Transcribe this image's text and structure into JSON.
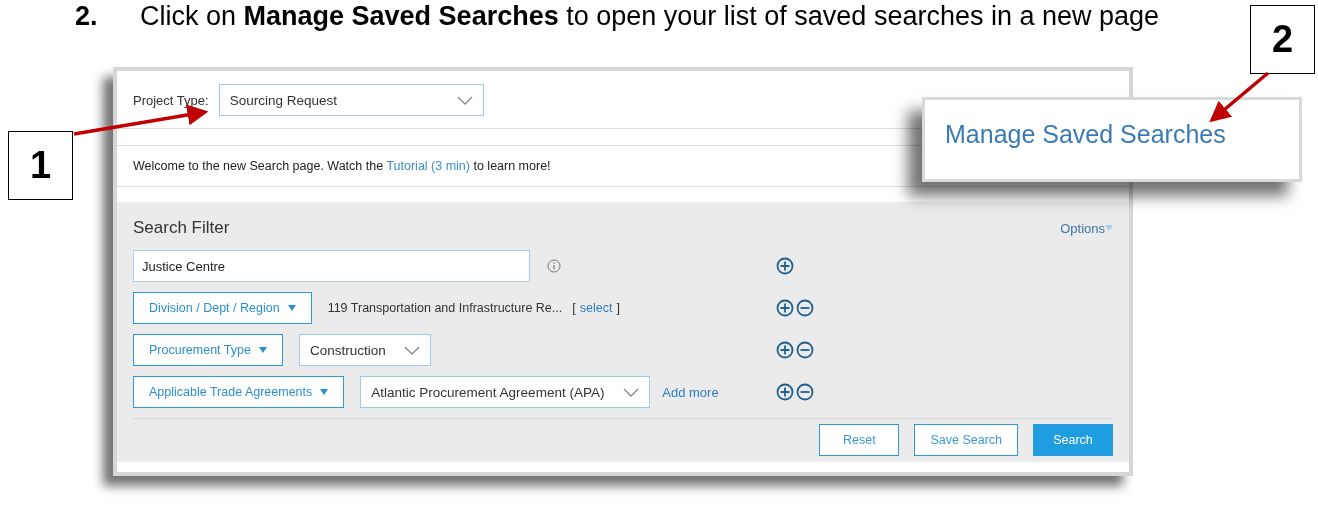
{
  "instruction": {
    "number": "2.",
    "text": "Click on **Manage Saved Searches** to open your list of saved searches in a new page"
  },
  "callouts": [
    {
      "label": "1"
    },
    {
      "label": "2"
    }
  ],
  "zoom_callout": {
    "text": "Manage Saved Searches"
  },
  "project_type": {
    "label": "Project Type:",
    "value": "Sourcing Request"
  },
  "welcome": {
    "before": "Welcome to the new Search page. Watch the ",
    "link": "Tutorial (3 min)",
    "after": " to learn more!"
  },
  "filter": {
    "title": "Search Filter",
    "options": "Options",
    "keyword": "Justice Centre",
    "removable": false,
    "rows": [
      {
        "kind": "picker",
        "button": "Division / Dept / Region",
        "value": "119 Transportation and Infrastructure Re...",
        "bracket_open": "[",
        "link": "select",
        "bracket_close": "]",
        "removable": true
      },
      {
        "kind": "dropdown",
        "button": "Procurement Type",
        "value": "Construction",
        "removable": true
      },
      {
        "kind": "dropdown",
        "button": "Applicable Trade Agreements",
        "value": "Atlantic Procurement Agreement (APA)",
        "add_more": "Add more",
        "removable": true
      }
    ]
  },
  "buttons": [
    {
      "label": "Reset",
      "primary": false
    },
    {
      "label": "Save Search",
      "primary": false
    },
    {
      "label": "Search",
      "primary": true
    }
  ]
}
